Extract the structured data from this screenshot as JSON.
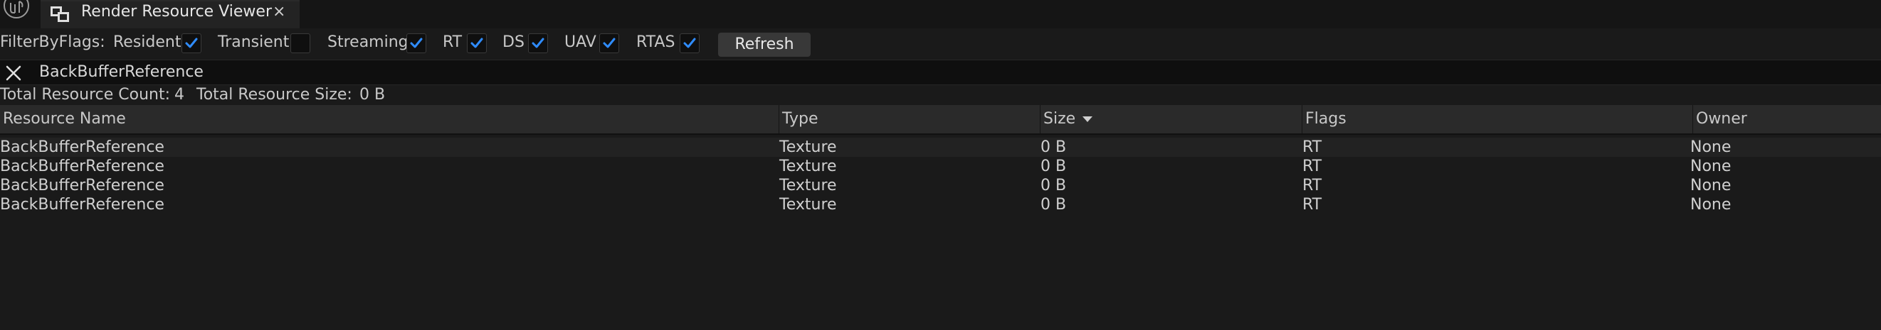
{
  "tab": {
    "title": "Render Resource Viewer",
    "close_glyph": "×",
    "icon": "render-resource-viewer-icon"
  },
  "filters": {
    "label": "FilterByFlags:",
    "items": [
      {
        "label": "Resident",
        "checked": true
      },
      {
        "label": "Transient",
        "checked": false
      },
      {
        "label": "Streaming",
        "checked": true
      },
      {
        "label": "RT",
        "checked": true
      },
      {
        "label": "DS",
        "checked": true
      },
      {
        "label": "UAV",
        "checked": true
      },
      {
        "label": "RTAS",
        "checked": true
      }
    ],
    "refresh_label": "Refresh"
  },
  "search": {
    "value": "BackBufferReference"
  },
  "summary": {
    "count_label": "Total Resource Count:",
    "count_value": "4",
    "size_label": "Total Resource Size:",
    "size_value": "0 B"
  },
  "table": {
    "columns": [
      "Resource Name",
      "Type",
      "Size",
      "Flags",
      "Owner"
    ],
    "sorted_column": "Size",
    "rows": [
      [
        "BackBufferReference",
        "Texture",
        "0 B",
        "RT",
        "None"
      ],
      [
        "BackBufferReference",
        "Texture",
        "0 B",
        "RT",
        "None"
      ],
      [
        "BackBufferReference",
        "Texture",
        "0 B",
        "RT",
        "None"
      ],
      [
        "BackBufferReference",
        "Texture",
        "0 B",
        "RT",
        "None"
      ]
    ]
  },
  "colors": {
    "background": "#1a1a1a",
    "checkbox_accent": "#2f8cff",
    "header_background": "#2a2a2a",
    "button_background": "#383838"
  }
}
